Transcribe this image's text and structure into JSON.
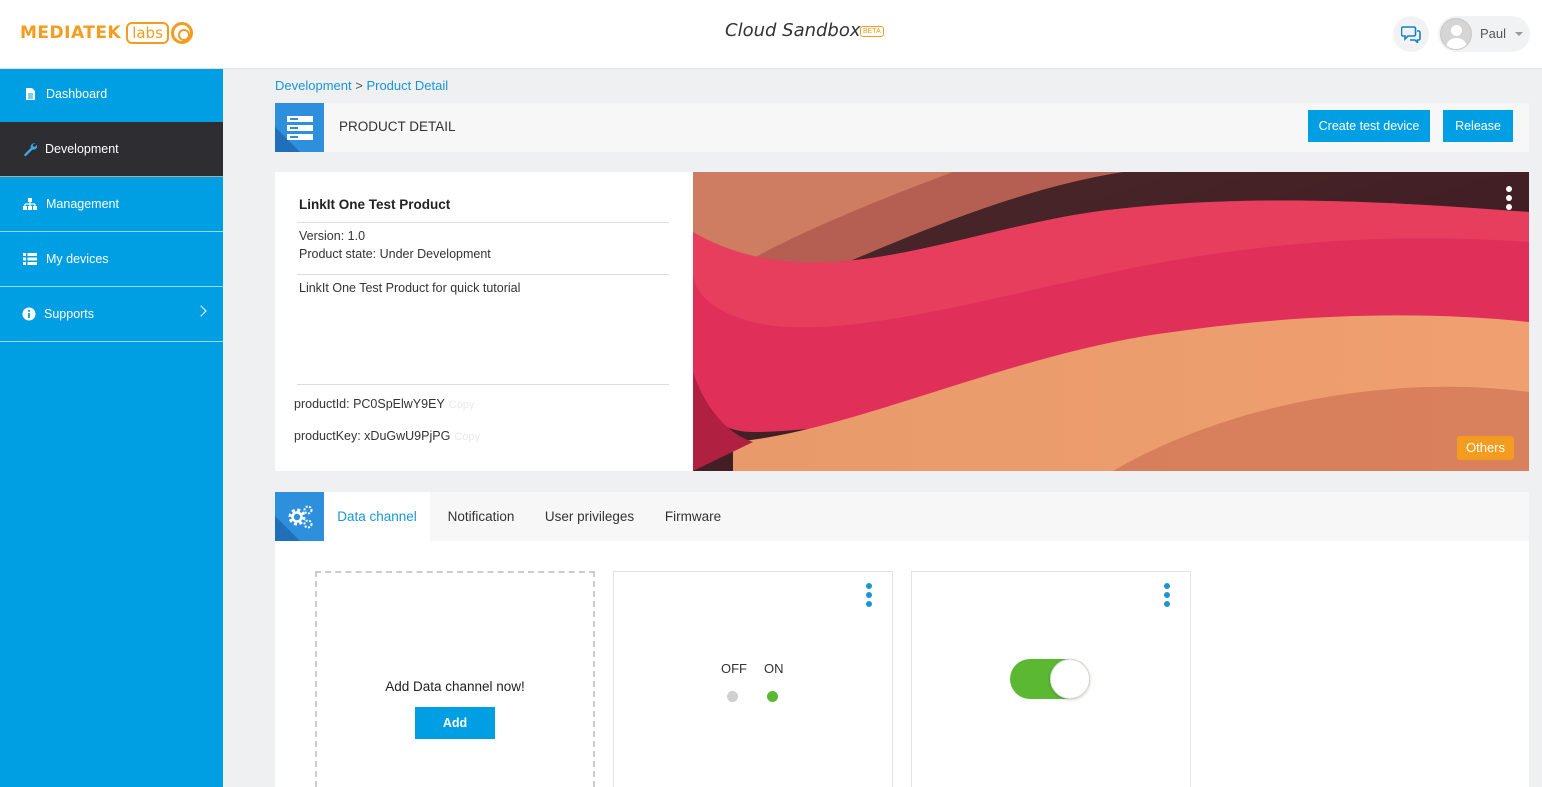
{
  "header": {
    "logo_text": "MEDIATEK",
    "logo_labs": "labs",
    "app_title": "Cloud Sandbox",
    "beta_badge": "BETA",
    "user_name": "Paul"
  },
  "sidebar": {
    "items": [
      {
        "label": "Dashboard",
        "icon": "document-icon"
      },
      {
        "label": "Development",
        "icon": "wrench-icon"
      },
      {
        "label": "Management",
        "icon": "sitemap-icon"
      },
      {
        "label": "My devices",
        "icon": "list-icon"
      },
      {
        "label": "Supports",
        "icon": "info-icon"
      }
    ],
    "active": "Development"
  },
  "breadcrumb": {
    "parent": "Development",
    "separator": ">",
    "current": "Product Detail"
  },
  "page": {
    "title": "PRODUCT DETAIL",
    "create_test_device": "Create test device",
    "release": "Release"
  },
  "product": {
    "name": "LinkIt One Test Product",
    "version": "Version: 1.0",
    "state": "Product state: Under Development",
    "description": "LinkIt One Test Product for quick tutorial",
    "product_id": "productId: PC0SpElwY9EY",
    "product_key": "productKey: xDuGwU9PjPG",
    "copy_label": "Copy",
    "category_badge": "Others"
  },
  "tabs": {
    "items": [
      "Data channel",
      "Notification",
      "User privileges",
      "Firmware"
    ],
    "active": "Data channel"
  },
  "data_channel": {
    "add_prompt": "Add Data channel now!",
    "add_button": "Add",
    "switch_off_label": "OFF",
    "switch_on_label": "ON"
  },
  "colors": {
    "brand": "#f39c1f",
    "sidebar": "#009fe3",
    "sidebar_active": "#2e2d31",
    "link": "#1c95d4",
    "on_green": "#5bb832"
  }
}
